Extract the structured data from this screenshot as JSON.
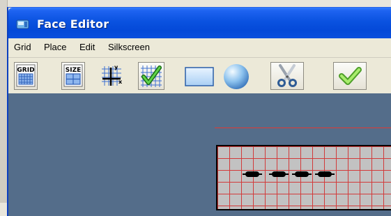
{
  "window": {
    "title": "Face Editor"
  },
  "menu": [
    "Grid",
    "Place",
    "Edit",
    "Silkscreen"
  ],
  "toolbar": {
    "grid_label": "GRID",
    "size_label": "SIZE",
    "axis_y": "y",
    "axis_x": "x",
    "buttons": [
      {
        "name": "grid-button",
        "icon": "grid-icon"
      },
      {
        "name": "size-button",
        "icon": "size-icon"
      },
      {
        "name": "axis-button",
        "icon": "axis-grid-icon"
      },
      {
        "name": "check-grid-button",
        "icon": "grid-check-icon"
      },
      {
        "name": "rectangle-button",
        "icon": "rectangle-icon"
      },
      {
        "name": "circle-button",
        "icon": "circle-icon"
      },
      {
        "name": "cut-button",
        "icon": "scissors-icon"
      },
      {
        "name": "accept-button",
        "icon": "checkmark-icon"
      }
    ]
  },
  "colors": {
    "title_blue": "#0449d8",
    "canvas_bg": "#546d8a",
    "grid_line": "#d23a3a",
    "board_fill": "#c2c2c2"
  },
  "pads": {
    "count": 4
  }
}
